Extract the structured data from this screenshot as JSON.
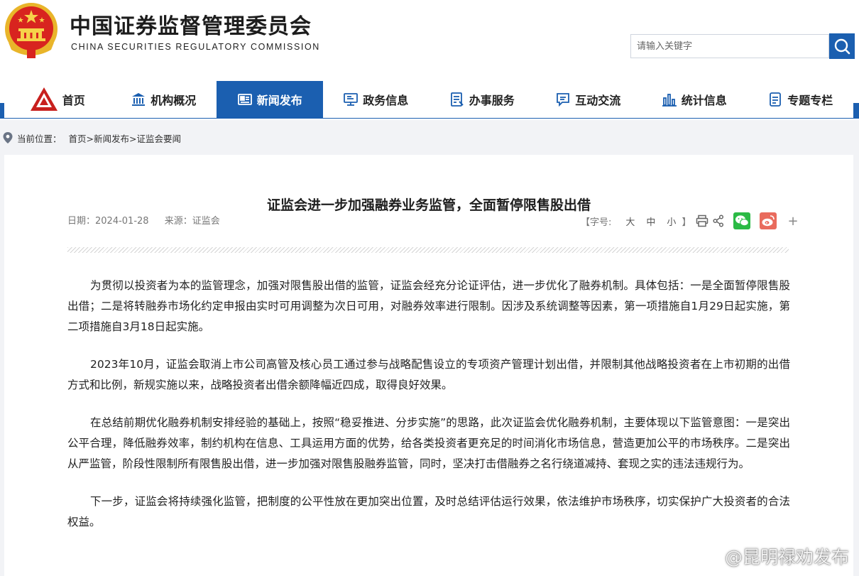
{
  "header": {
    "site_title": "中国证券监督管理委员会",
    "site_subtitle": "CHINA SECURITIES REGULATORY COMMISSION",
    "search_placeholder": "请输入关键字"
  },
  "nav": {
    "items": [
      {
        "label": "首页",
        "icon": "home-logo-icon"
      },
      {
        "label": "机构概况",
        "icon": "building-icon"
      },
      {
        "label": "新闻发布",
        "icon": "newspaper-icon",
        "active": true
      },
      {
        "label": "政务信息",
        "icon": "monitor-icon"
      },
      {
        "label": "办事服务",
        "icon": "form-icon"
      },
      {
        "label": "互动交流",
        "icon": "chat-icon"
      },
      {
        "label": "统计信息",
        "icon": "bar-chart-icon"
      },
      {
        "label": "专题专栏",
        "icon": "document-icon"
      }
    ]
  },
  "breadcrumb": {
    "label": "当前位置：",
    "path": "首页>新闻发布>证监会要闻"
  },
  "article": {
    "title": "证监会进一步加强融券业务监管，全面暂停限售股出借",
    "date": "日期：2024-01-28",
    "source": "来源：证监会",
    "font_size_label": "【字号:",
    "font_large": "大",
    "font_medium": "中",
    "font_small": "小",
    "font_end": "】",
    "more": "+",
    "paragraphs": [
      "为贯彻以投资者为本的监管理念，加强对限售股出借的监管，证监会经充分论证评估，进一步优化了融券机制。具体包括：一是全面暂停限售股出借；二是将转融券市场化约定申报由实时可用调整为次日可用，对融券效率进行限制。因涉及系统调整等因素，第一项措施自1月29日起实施，第二项措施自3月18日起实施。",
      "2023年10月，证监会取消上市公司高管及核心员工通过参与战略配售设立的专项资产管理计划出借，并限制其他战略投资者在上市初期的出借方式和比例，新规实施以来，战略投资者出借余额降幅近四成，取得良好效果。",
      "在总结前期优化融券机制安排经验的基础上，按照“稳妥推进、分步实施”的思路，此次证监会优化融券机制，主要体现以下监管意图：一是突出公平合理，降低融券效率，制约机构在信息、工具运用方面的优势，给各类投资者更充足的时间消化市场信息，营造更加公平的市场秩序。二是突出从严监管，阶段性限制所有限售股出借，进一步加强对限售股融券监管，同时，坚决打击借融券之名行绕道减持、套现之实的违法违规行为。",
      "下一步，证监会将持续强化监管，把制度的公平性放在更加突出位置，及时总结评估运行效果，依法维护市场秩序，切实保护广大投资者的合法权益。"
    ]
  },
  "watermark": "@昆明禄劝发布",
  "colors": {
    "brand_blue": "#1b5fb0",
    "wechat_green": "#2bba45",
    "weibo_red": "#e96b5d",
    "emblem_red": "#d8241f",
    "emblem_gold": "#f0c23b"
  }
}
